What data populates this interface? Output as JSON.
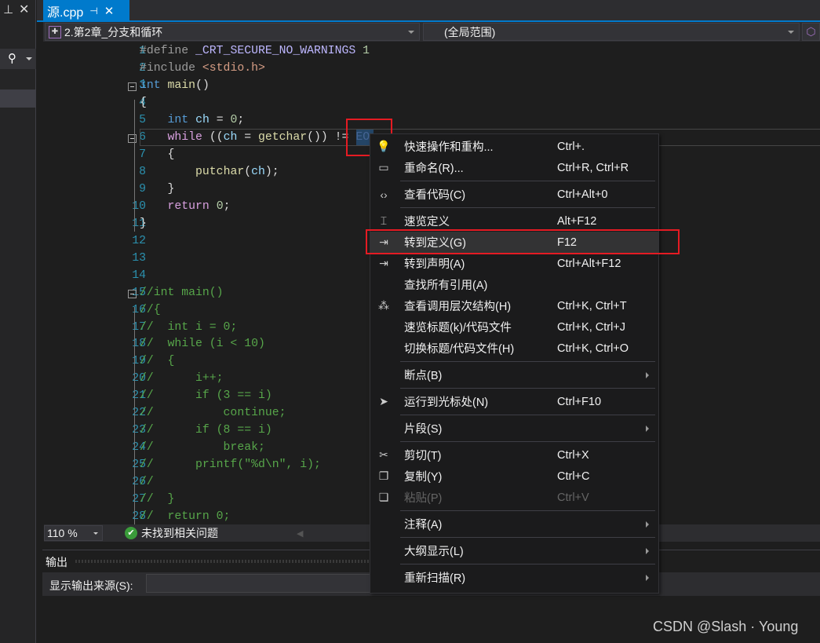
{
  "window": {
    "tab_title": "源.cpp",
    "pin_icon": "pin-icon",
    "close_icon": "close-icon"
  },
  "navbar": {
    "project": "2.第2章_分支和循环",
    "scope": "(全局范围)"
  },
  "code_lines": [
    [
      [
        "#define ",
        "pp"
      ],
      [
        "_CRT_SECURE_NO_WARNINGS",
        "mac"
      ],
      [
        " 1",
        "num"
      ]
    ],
    [
      [
        "#include ",
        "pp"
      ],
      [
        "<stdio.h>",
        "str"
      ]
    ],
    [
      [
        "int",
        "kw"
      ],
      [
        " ",
        ""
      ],
      [
        "main",
        "fn"
      ],
      [
        "()",
        ""
      ]
    ],
    [
      [
        "{",
        ""
      ]
    ],
    [
      [
        "    ",
        ""
      ],
      [
        "int",
        "kw"
      ],
      [
        " ",
        ""
      ],
      [
        "ch",
        "var"
      ],
      [
        " = ",
        ""
      ],
      [
        "0",
        "num"
      ],
      [
        ";",
        ""
      ]
    ],
    [
      [
        "    ",
        ""
      ],
      [
        "while",
        "ctl"
      ],
      [
        " ((",
        ""
      ],
      [
        "ch",
        "var"
      ],
      [
        " = ",
        ""
      ],
      [
        "getchar",
        "fn"
      ],
      [
        "()) != ",
        ""
      ],
      [
        "EO",
        "mac"
      ]
    ],
    [
      [
        "    {",
        ""
      ]
    ],
    [
      [
        "        ",
        ""
      ],
      [
        "putchar",
        "fn"
      ],
      [
        "(",
        ""
      ],
      [
        "ch",
        "var"
      ],
      [
        ");",
        ""
      ]
    ],
    [
      [
        "    }",
        ""
      ]
    ],
    [
      [
        "    ",
        ""
      ],
      [
        "return",
        "ctl"
      ],
      [
        " ",
        ""
      ],
      [
        "0",
        "num"
      ],
      [
        ";",
        ""
      ]
    ],
    [
      [
        "}",
        ""
      ]
    ],
    [],
    [],
    [],
    [
      [
        "//int main()",
        "cm"
      ]
    ],
    [
      [
        "//{",
        "cm"
      ]
    ],
    [
      [
        "//  int i = 0;",
        "cm"
      ]
    ],
    [
      [
        "//  while (i < 10)",
        "cm"
      ]
    ],
    [
      [
        "//  {",
        "cm"
      ]
    ],
    [
      [
        "//      i++;",
        "cm"
      ]
    ],
    [
      [
        "//      if (3 == i)",
        "cm"
      ]
    ],
    [
      [
        "//          continue;",
        "cm"
      ]
    ],
    [
      [
        "//      if (8 == i)",
        "cm"
      ]
    ],
    [
      [
        "//          break;",
        "cm"
      ]
    ],
    [
      [
        "//      printf(″%d\\n″, i);",
        "cm"
      ]
    ],
    [
      [
        "//",
        "cm"
      ]
    ],
    [
      [
        "//  }",
        "cm"
      ]
    ],
    [
      [
        "//  return 0;",
        "cm"
      ]
    ]
  ],
  "status": {
    "zoom": "110 %",
    "issues": "未找到相关问题"
  },
  "output": {
    "title": "输出",
    "source_label": "显示输出来源(S):"
  },
  "context_menu": [
    {
      "icon": "lightbulb-icon",
      "label": "快速操作和重构...",
      "shortcut": "Ctrl+."
    },
    {
      "icon": "rename-icon",
      "label": "重命名(R)...",
      "shortcut": "Ctrl+R, Ctrl+R"
    },
    {
      "sep": true
    },
    {
      "icon": "code-icon",
      "label": "查看代码(C)",
      "shortcut": "Ctrl+Alt+0"
    },
    {
      "sep": true
    },
    {
      "icon": "peek-definition-icon",
      "label": "速览定义",
      "shortcut": "Alt+F12"
    },
    {
      "icon": "go-to-definition-icon",
      "label": "转到定义(G)",
      "shortcut": "F12",
      "highlight": true
    },
    {
      "icon": "go-to-declaration-icon",
      "label": "转到声明(A)",
      "shortcut": "Ctrl+Alt+F12"
    },
    {
      "label": "查找所有引用(A)",
      "shortcut": ""
    },
    {
      "icon": "call-hierarchy-icon",
      "label": "查看调用层次结构(H)",
      "shortcut": "Ctrl+K, Ctrl+T"
    },
    {
      "label": "速览标题(k)/代码文件",
      "shortcut": "Ctrl+K, Ctrl+J"
    },
    {
      "label": "切换标题/代码文件(H)",
      "shortcut": "Ctrl+K, Ctrl+O"
    },
    {
      "sep": true
    },
    {
      "label": "断点(B)",
      "shortcut": "",
      "submenu": true
    },
    {
      "sep": true
    },
    {
      "icon": "cursor-icon",
      "label": "运行到光标处(N)",
      "shortcut": "Ctrl+F10"
    },
    {
      "sep": true
    },
    {
      "label": "片段(S)",
      "shortcut": "",
      "submenu": true
    },
    {
      "sep": true
    },
    {
      "icon": "scissors-icon",
      "label": "剪切(T)",
      "shortcut": "Ctrl+X"
    },
    {
      "icon": "copy-icon",
      "label": "复制(Y)",
      "shortcut": "Ctrl+C"
    },
    {
      "icon": "paste-icon",
      "label": "粘贴(P)",
      "shortcut": "Ctrl+V",
      "disabled": true
    },
    {
      "sep": true
    },
    {
      "label": "注释(A)",
      "shortcut": "",
      "submenu": true
    },
    {
      "sep": true
    },
    {
      "label": "大纲显示(L)",
      "shortcut": "",
      "submenu": true
    },
    {
      "sep": true
    },
    {
      "label": "重新扫描(R)",
      "shortcut": "",
      "submenu": true
    }
  ],
  "watermark": "CSDN @Slash · Young",
  "colors": {
    "accent": "#007acc",
    "highlight_box": "#e51b23",
    "background": "#1e1e1e"
  }
}
